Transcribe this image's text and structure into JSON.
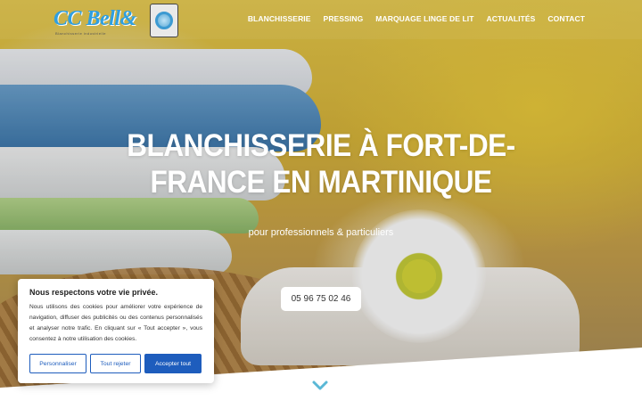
{
  "header": {
    "logo": {
      "text": "CC Bell&",
      "subtitle": "Blanchisserie industrielle"
    },
    "nav": [
      {
        "label": "BLANCHISSERIE"
      },
      {
        "label": "PRESSING"
      },
      {
        "label": "MARQUAGE LINGE DE LIT"
      },
      {
        "label": "ACTUALITÉS"
      },
      {
        "label": "CONTACT"
      }
    ]
  },
  "hero": {
    "title": "BLANCHISSERIE À FORT-DE-FRANCE EN MARTINIQUE",
    "subtitle": "pour professionnels & particuliers",
    "phone_button": "05 96 75 02 46",
    "scroll_icon": "chevron-down-icon"
  },
  "cookie_banner": {
    "title": "Nous respectons votre vie privée.",
    "text": "Nous utilisons des cookies pour améliorer votre expérience de navigation, diffuser des publicités ou des contenus personnalisés et analyser notre trafic. En cliquant sur « Tout accepter », vous consentez à notre utilisation des cookies.",
    "buttons": {
      "customize": "Personnaliser",
      "reject": "Tout rejeter",
      "accept": "Accepter tout"
    }
  },
  "colors": {
    "accent": "#1e5dbd",
    "logo_blue": "#2f9fe0",
    "chevron": "#5ab8d6"
  }
}
